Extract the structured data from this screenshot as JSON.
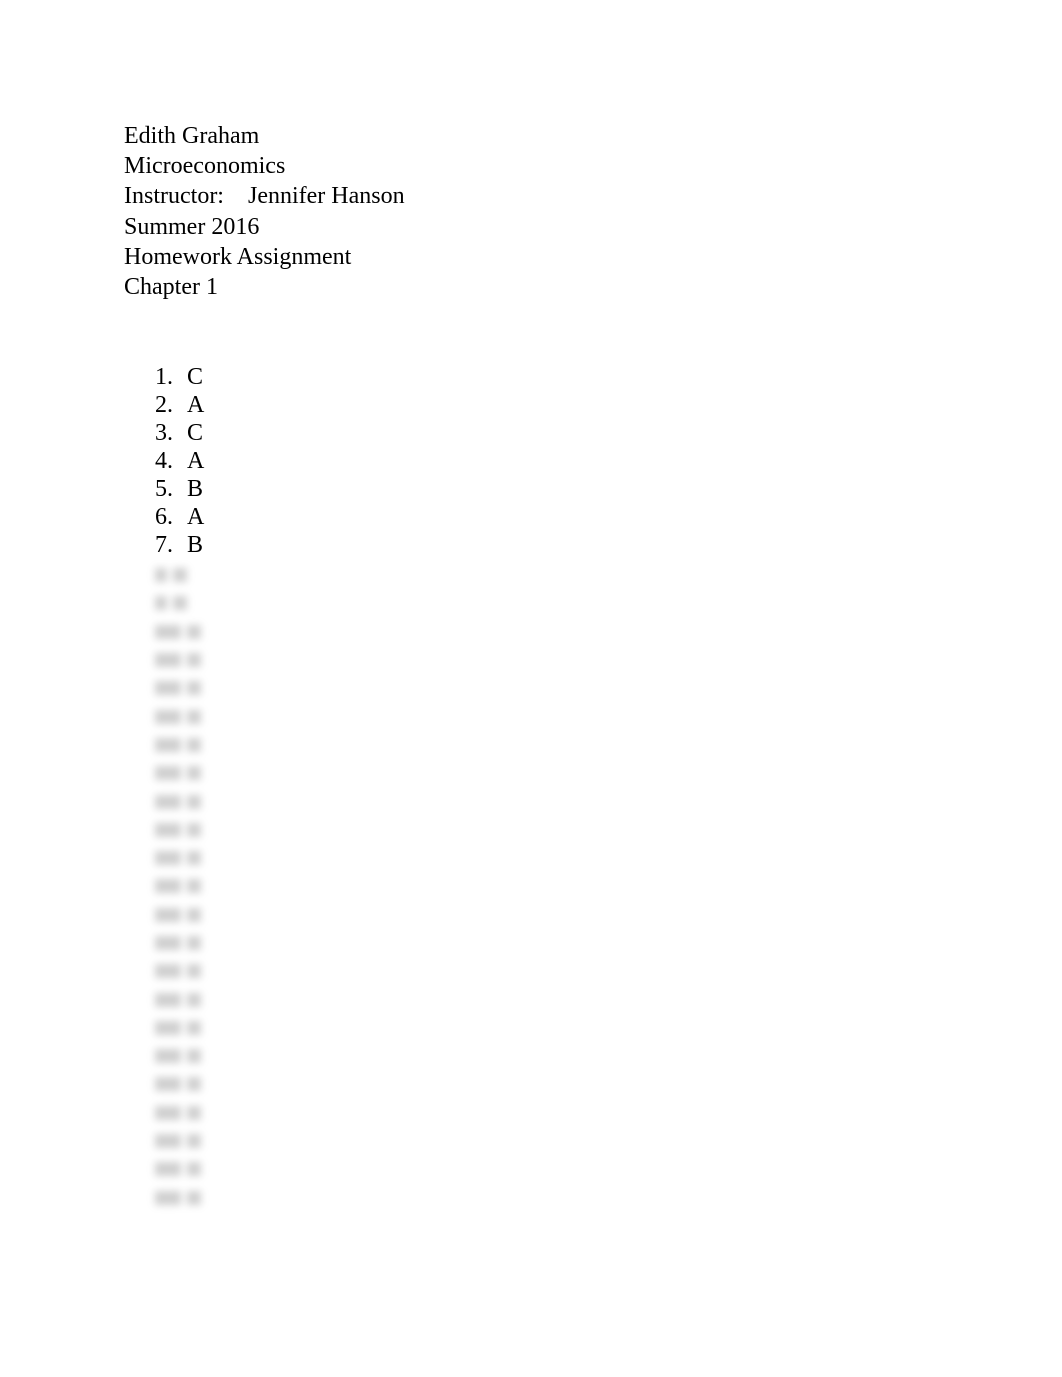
{
  "document": {
    "header_lines": [
      "Edith Graham",
      "Microeconomics",
      "Instructor:    Jennifer Hanson",
      "Summer 2016",
      "Homework Assignment",
      "Chapter 1"
    ],
    "answers": [
      {
        "number": "1.",
        "answer": "C"
      },
      {
        "number": "2.",
        "answer": "A"
      },
      {
        "number": "3.",
        "answer": "C"
      },
      {
        "number": "4.",
        "answer": "A"
      },
      {
        "number": "5.",
        "answer": "B"
      },
      {
        "number": "6.",
        "answer": "A"
      },
      {
        "number": "7.",
        "answer": "B"
      }
    ],
    "blurred_answer_count": 23
  }
}
